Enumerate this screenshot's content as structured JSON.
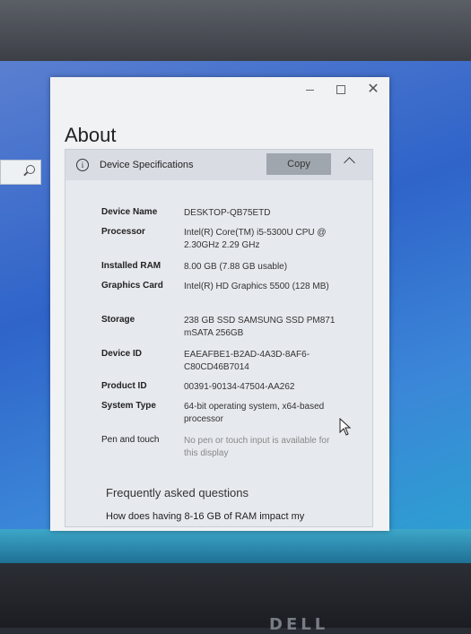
{
  "window": {
    "title": "About",
    "controls": {
      "close_symbol": "✕"
    }
  },
  "device_specs": {
    "header": "Device Specifications",
    "copy_label": "Copy",
    "info_symbol": "i",
    "rows": [
      {
        "label": "Device Name",
        "value": "DESKTOP-QB75ETD"
      },
      {
        "label": "Processor",
        "value": "Intel(R) Core(TM) i5-5300U CPU @ 2.30GHz 2.29 GHz"
      },
      {
        "label": "Installed RAM",
        "value": "8.00 GB (7.88 GB usable)"
      },
      {
        "label": "Graphics Card",
        "value": "Intel(R) HD Graphics 5500 (128 MB)"
      },
      {
        "label": "Storage",
        "value": "238 GB SSD SAMSUNG SSD PM871 mSATA 256GB"
      },
      {
        "label": "Device ID",
        "value": "EAEAFBE1-B2AD-4A3D-8AF6-C80CD46B7014"
      },
      {
        "label": "Product ID",
        "value": "00391-90134-47504-AA262"
      },
      {
        "label": "System Type",
        "value": "64-bit operating system, x64-based processor"
      },
      {
        "label": "Pen and touch",
        "value": "No pen or touch input is available for this display"
      }
    ]
  },
  "faq": {
    "title": "Frequently asked questions",
    "first_link": "How does having 8-16 GB of RAM impact my"
  },
  "bezel": {
    "brand": "DELL"
  }
}
